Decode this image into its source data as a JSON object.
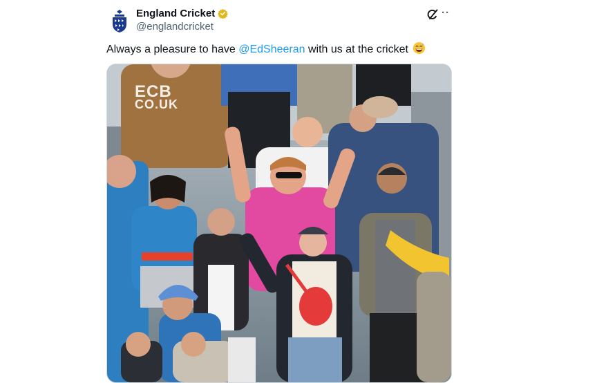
{
  "account": {
    "display_name": "England Cricket",
    "handle": "@englandcricket"
  },
  "post": {
    "text_before": "Always a pleasure to have ",
    "mention": "@EdSheeran",
    "text_after": " with us at the cricket",
    "emoji": "grinning-sweat-emoji"
  },
  "actions": {
    "grok_icon": "grok-icon",
    "more_label": "··"
  },
  "media": {
    "type": "video",
    "watermark_line1": "ECB",
    "watermark_line2": "CO.UK"
  },
  "colors": {
    "text": "#0f1419",
    "secondary": "#536471",
    "link": "#1d9bf0",
    "verified": "#e2b719",
    "border": "#cfd9de"
  }
}
